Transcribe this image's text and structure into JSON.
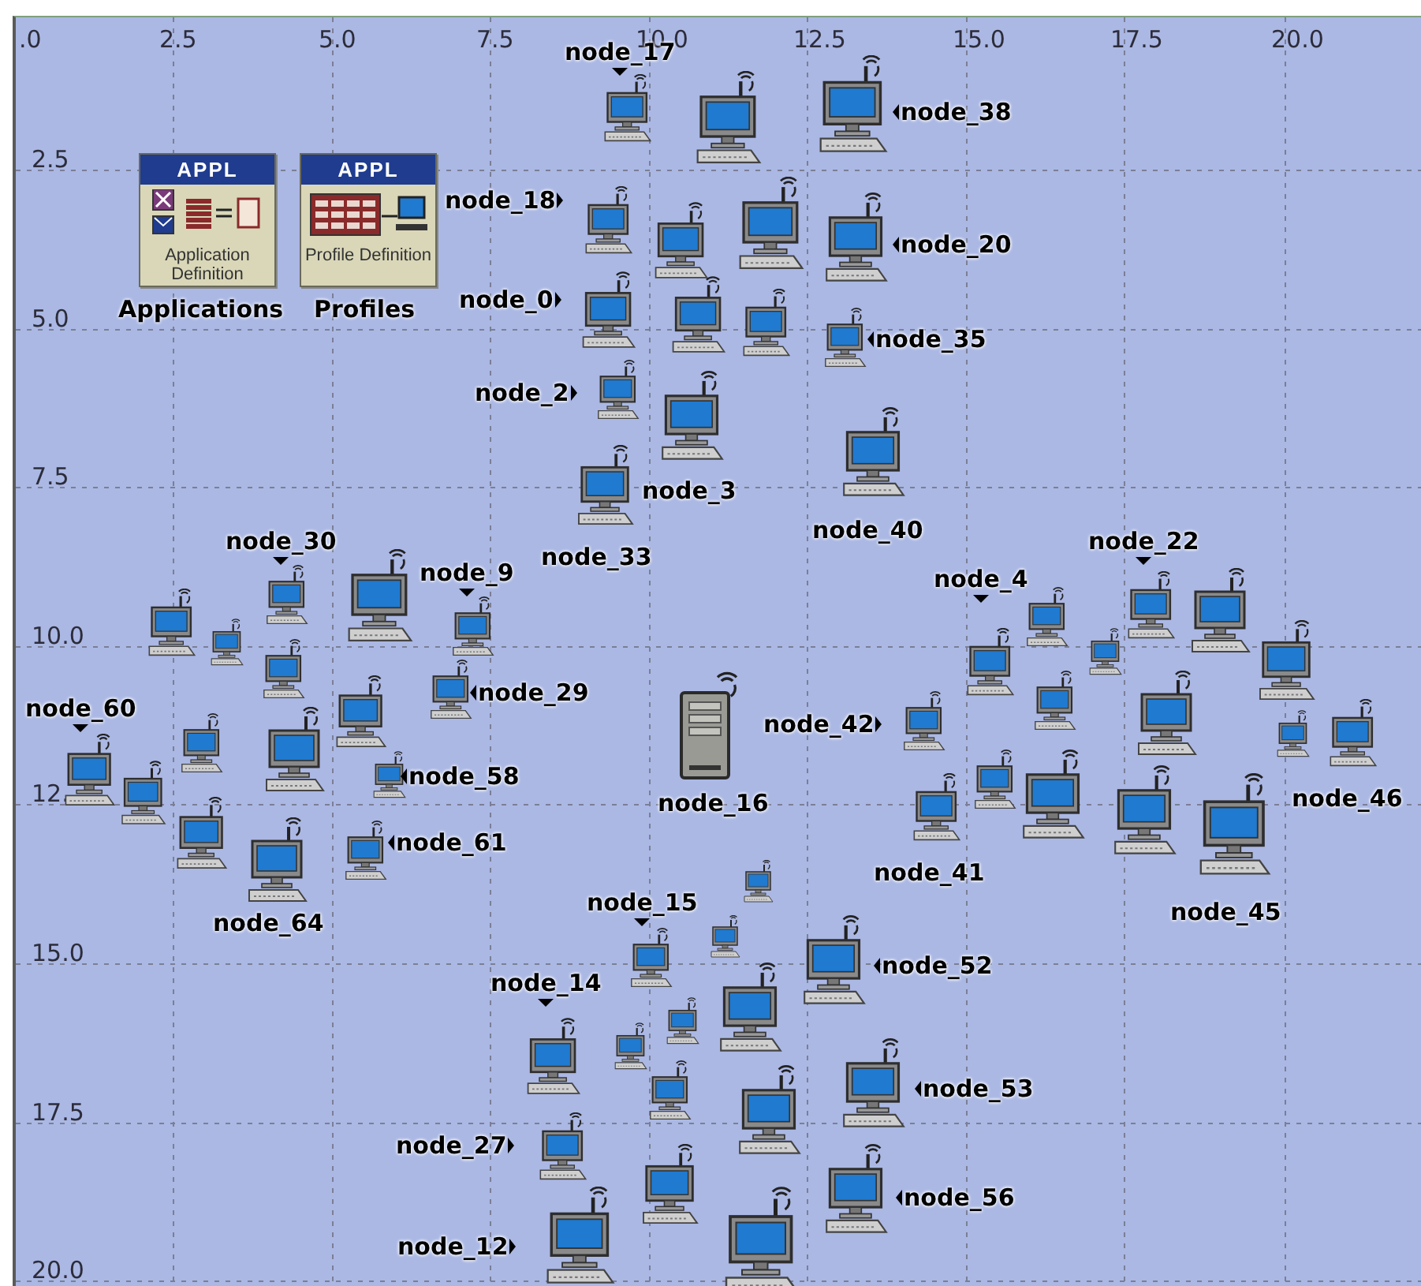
{
  "axes": {
    "x_ticks": [
      ".0",
      "2.5",
      "5.0",
      "7.5",
      "10.0",
      "12.5",
      "15.0",
      "17.5",
      "20.0"
    ],
    "y_ticks": [
      "2.5",
      "5.0",
      "7.5",
      "10.0",
      "12.",
      "15.0",
      "17.5",
      "20.0"
    ]
  },
  "config_objects": [
    {
      "kind": "application",
      "badge": "APPL",
      "title": "Application Definition",
      "caption": "Applications"
    },
    {
      "kind": "profile",
      "badge": "APPL",
      "title": "Profile Definition",
      "caption": "Profiles"
    }
  ],
  "nodes": [
    {
      "kind": "workstation",
      "label": "node_17"
    },
    {
      "kind": "workstation"
    },
    {
      "kind": "workstation",
      "label": "node_38"
    },
    {
      "kind": "workstation",
      "label": "node_18"
    },
    {
      "kind": "workstation"
    },
    {
      "kind": "workstation"
    },
    {
      "kind": "workstation",
      "label": "node_20"
    },
    {
      "kind": "workstation",
      "label": "node_0"
    },
    {
      "kind": "workstation"
    },
    {
      "kind": "workstation"
    },
    {
      "kind": "workstation",
      "label": "node_35"
    },
    {
      "kind": "workstation",
      "label": "node_2"
    },
    {
      "kind": "workstation",
      "label": "node_3"
    },
    {
      "kind": "workstation",
      "label": "node_40"
    },
    {
      "kind": "workstation",
      "label": "node_33"
    },
    {
      "kind": "workstation"
    },
    {
      "kind": "workstation"
    },
    {
      "kind": "workstation",
      "label": "node_30"
    },
    {
      "kind": "workstation"
    },
    {
      "kind": "workstation",
      "label": "node_9"
    },
    {
      "kind": "workstation"
    },
    {
      "kind": "workstation"
    },
    {
      "kind": "workstation",
      "label": "node_29"
    },
    {
      "kind": "workstation",
      "label": "node_60"
    },
    {
      "kind": "workstation"
    },
    {
      "kind": "workstation"
    },
    {
      "kind": "workstation"
    },
    {
      "kind": "workstation",
      "label": "node_58"
    },
    {
      "kind": "workstation"
    },
    {
      "kind": "workstation",
      "label": "node_61"
    },
    {
      "kind": "workstation",
      "label": "node_64"
    },
    {
      "kind": "workstation",
      "label": "node_22"
    },
    {
      "kind": "workstation"
    },
    {
      "kind": "workstation",
      "label": "node_4"
    },
    {
      "kind": "workstation"
    },
    {
      "kind": "workstation"
    },
    {
      "kind": "workstation"
    },
    {
      "kind": "workstation"
    },
    {
      "kind": "workstation"
    },
    {
      "kind": "server",
      "label": "node_16"
    },
    {
      "kind": "workstation",
      "label": "node_42"
    },
    {
      "kind": "workstation"
    },
    {
      "kind": "workstation",
      "label": "node_46"
    },
    {
      "kind": "workstation"
    },
    {
      "kind": "workstation"
    },
    {
      "kind": "workstation"
    },
    {
      "kind": "workstation",
      "label": "node_41"
    },
    {
      "kind": "workstation",
      "label": "node_45"
    },
    {
      "kind": "workstation"
    },
    {
      "kind": "workstation",
      "label": "node_15"
    },
    {
      "kind": "workstation"
    },
    {
      "kind": "workstation",
      "label": "node_52"
    },
    {
      "kind": "workstation",
      "label": "node_14"
    },
    {
      "kind": "workstation"
    },
    {
      "kind": "workstation"
    },
    {
      "kind": "workstation"
    },
    {
      "kind": "workstation"
    },
    {
      "kind": "workstation",
      "label": "node_53"
    },
    {
      "kind": "workstation"
    },
    {
      "kind": "workstation",
      "label": "node_27"
    },
    {
      "kind": "workstation"
    },
    {
      "kind": "workstation",
      "label": "node_56"
    },
    {
      "kind": "workstation"
    },
    {
      "kind": "workstation",
      "label": "node_12"
    }
  ]
}
